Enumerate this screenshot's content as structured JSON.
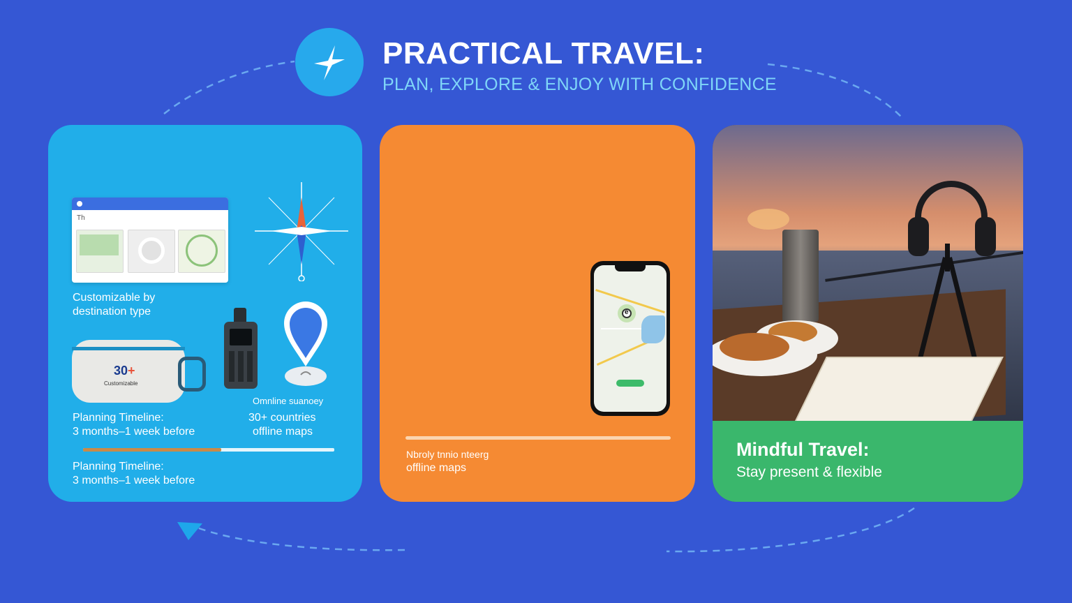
{
  "header": {
    "title": "PRACTICAL TRAVEL:",
    "subtitle": "PLAN, EXPLORE & ENJOY WITH CONFIDENCE"
  },
  "colors": {
    "background": "#3557d4",
    "accent_cyan": "#27a9ec",
    "card_blue": "#21aee9",
    "card_orange": "#f58a33",
    "card_green": "#3ab76c",
    "subtitle": "#7fd6f8"
  },
  "icons": {
    "logo": "plane-compass-icon",
    "compass": "compass-rose-icon",
    "pin": "location-pin-icon"
  },
  "card_blue": {
    "browser": {
      "bar_text": "",
      "heading": "Th"
    },
    "customizable_line1": "Customizable by",
    "customizable_line2": "destination type",
    "bag_badge_number": "30",
    "bag_badge_plus": "+",
    "bag_small_text": "Customizable",
    "offline_garbled": "Omnline suanoey",
    "countries_line1": "30+ countries",
    "countries_line2": "offline maps",
    "timeline1_line1": "Planning Timeline:",
    "timeline1_line2": "3 months–1 week before",
    "timeline2_line1": "Planning Timeline:",
    "timeline2_line2": "3 months–1 week before"
  },
  "card_orange": {
    "garbled_line": "Nbroly tnnio nteerg",
    "offline_maps": "offline maps",
    "phone_marker": "e"
  },
  "card_photo": {
    "mindful_title": "Mindful Travel:",
    "mindful_subtitle": "Stay present & flexible"
  }
}
